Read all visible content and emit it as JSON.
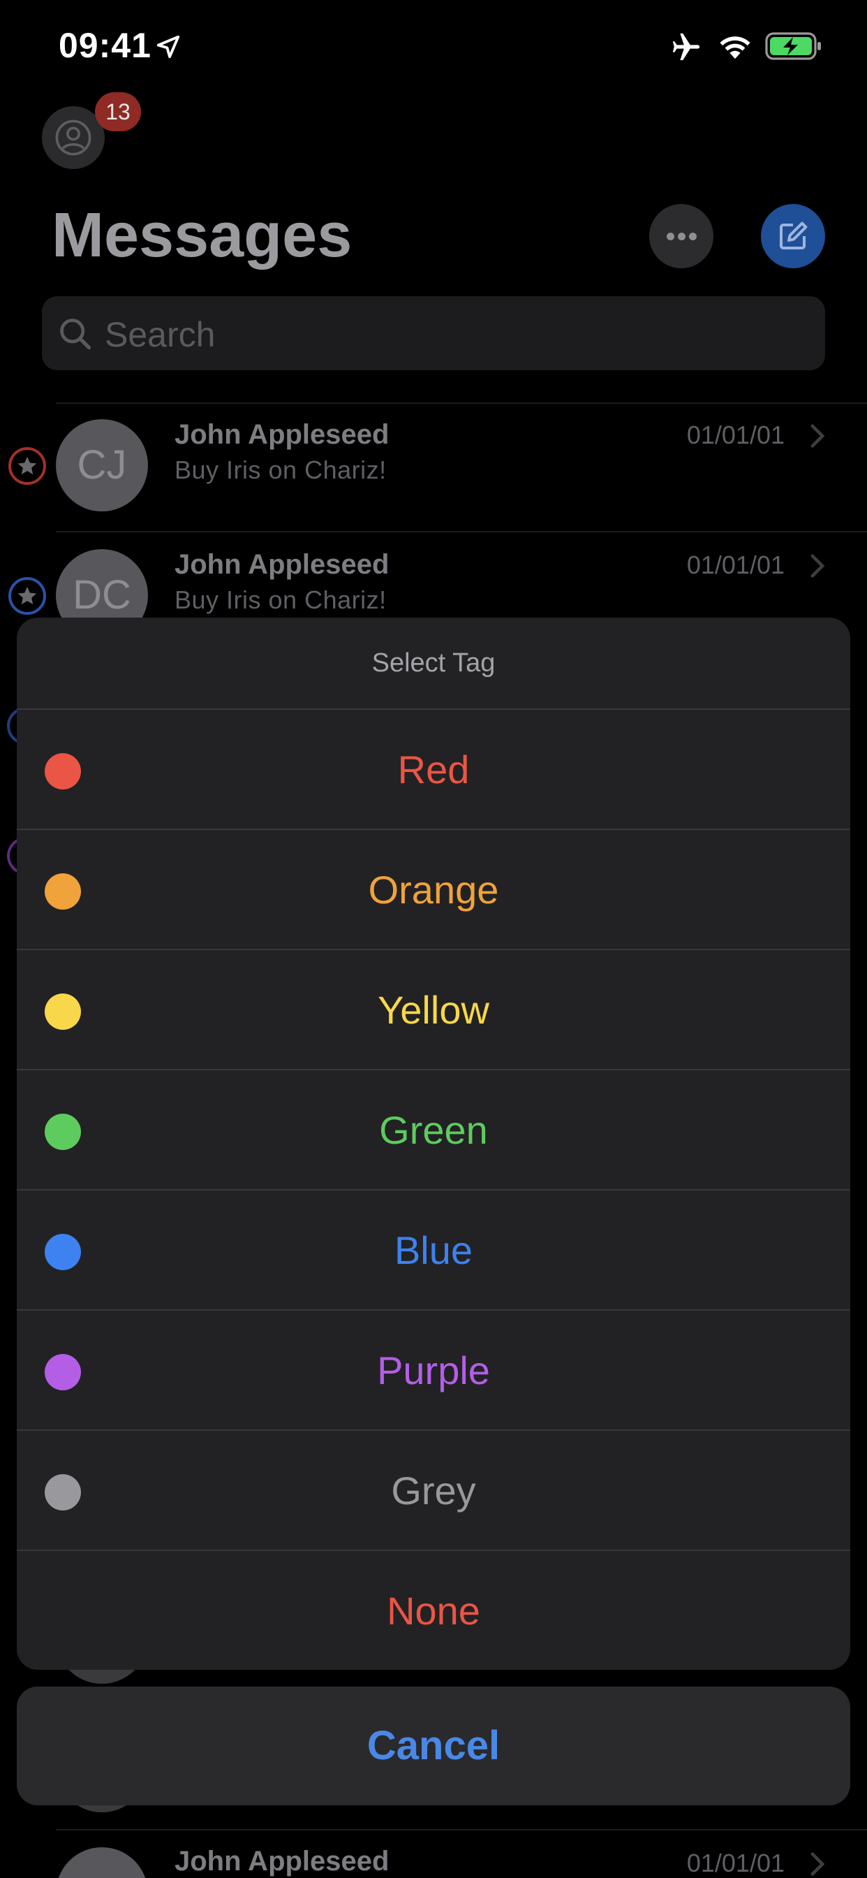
{
  "status_bar": {
    "time": "09:41",
    "icons": [
      "location-arrow-icon",
      "airplane-icon",
      "wifi-icon",
      "battery-charging-icon"
    ]
  },
  "header": {
    "badge_count": "13",
    "title": "Messages",
    "more_icon": "ellipsis-icon",
    "compose_icon": "compose-icon"
  },
  "search": {
    "placeholder": "Search"
  },
  "messages": [
    {
      "initials": "CJ",
      "name": "John Appleseed",
      "preview": "Buy Iris on Chariz!",
      "date": "01/01/01",
      "tag_color": "#c0392b"
    },
    {
      "initials": "DC",
      "name": "John Appleseed",
      "preview": "Buy Iris on Chariz!",
      "date": "01/01/01",
      "tag_color": "#2f5fbf"
    },
    {
      "initials": "",
      "name": "John Appleseed",
      "preview": "",
      "date": "01/01/01",
      "tag_color": ""
    }
  ],
  "action_sheet": {
    "title": "Select Tag",
    "options": [
      {
        "label": "Red",
        "color": "#eb5545"
      },
      {
        "label": "Orange",
        "color": "#f0a23b"
      },
      {
        "label": "Yellow",
        "color": "#f8d74a"
      },
      {
        "label": "Green",
        "color": "#5ecb5e"
      },
      {
        "label": "Blue",
        "color": "#3d82f0"
      },
      {
        "label": "Purple",
        "color": "#b45ee8"
      },
      {
        "label": "Grey",
        "color": "#98989d"
      },
      {
        "label": "None",
        "color": "#eb5545"
      }
    ],
    "cancel_label": "Cancel"
  }
}
